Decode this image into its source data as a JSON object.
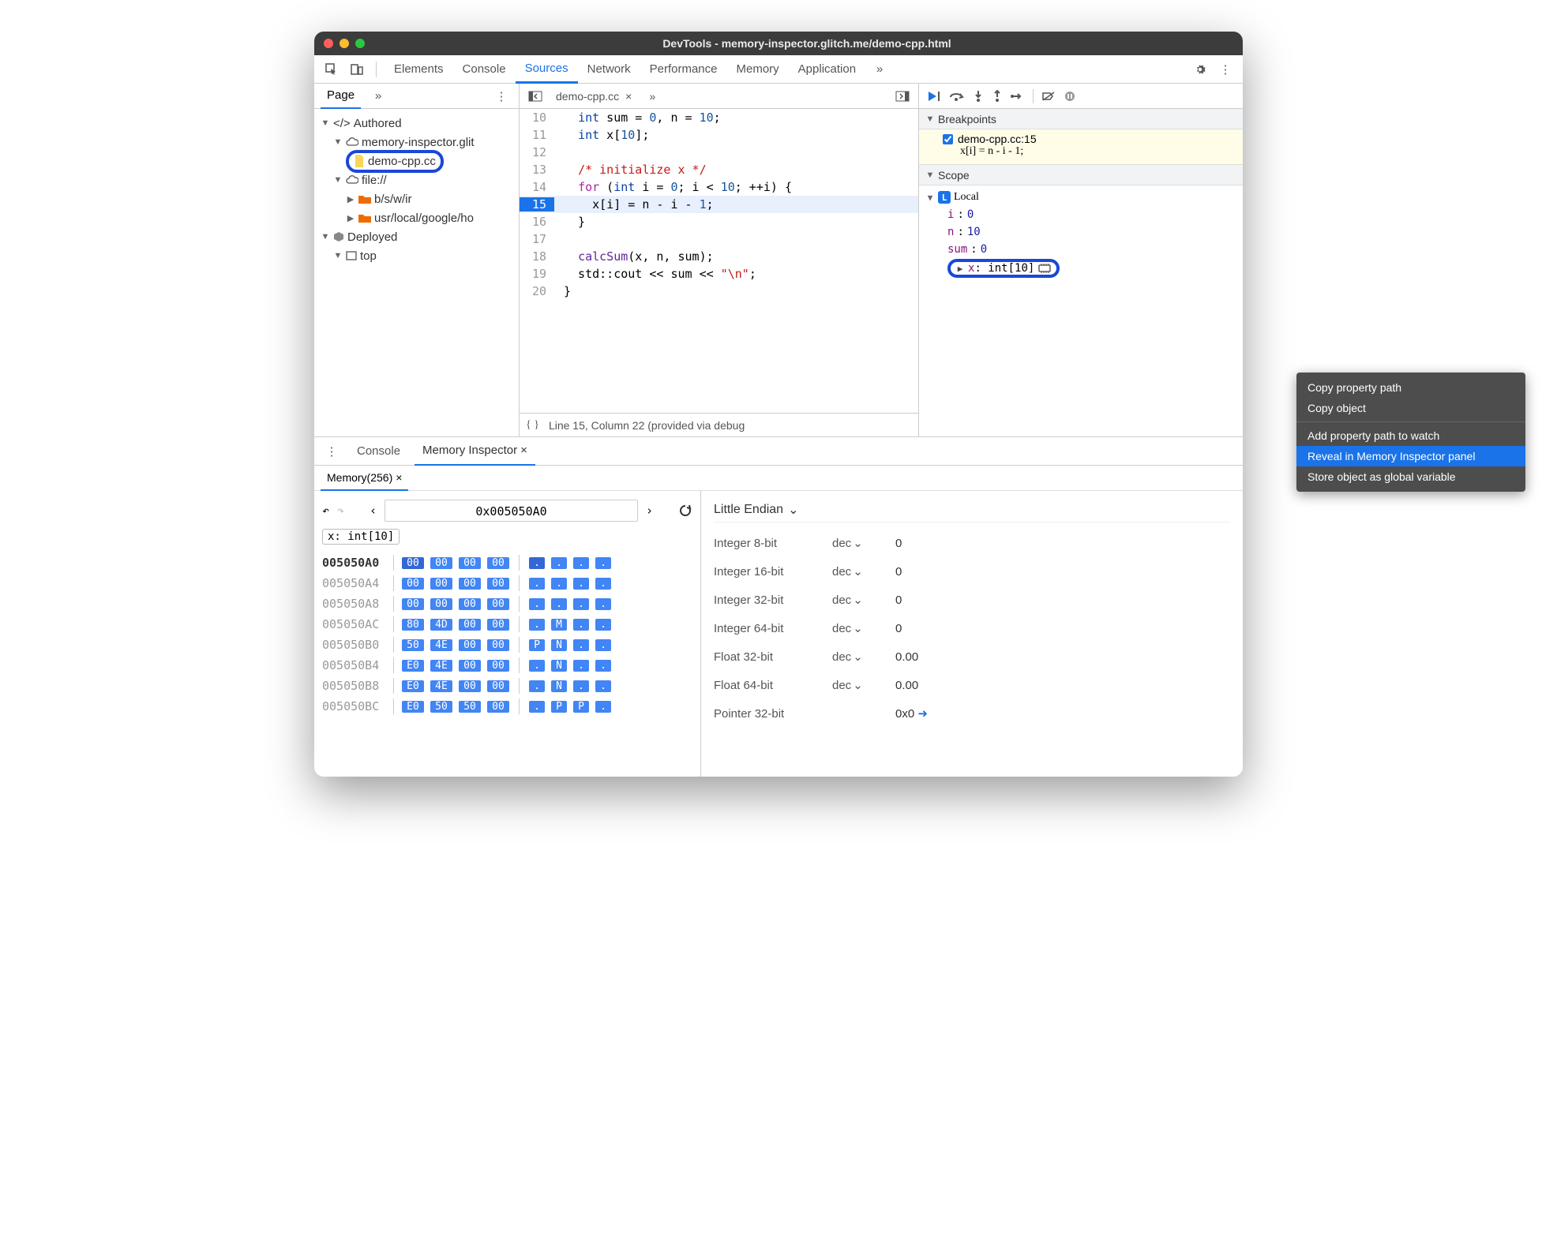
{
  "title": "DevTools - memory-inspector.glitch.me/demo-cpp.html",
  "tabs": [
    "Elements",
    "Console",
    "Sources",
    "Network",
    "Performance",
    "Memory",
    "Application"
  ],
  "activeTab": "Sources",
  "nav": {
    "pageTab": "Page",
    "tree": {
      "authored": "Authored",
      "host": "memory-inspector.glit",
      "file": "demo-cpp.cc",
      "filescheme": "file://",
      "bsw": "b/s/w/ir",
      "usr": "usr/local/google/ho",
      "deployed": "Deployed",
      "top": "top"
    }
  },
  "editor": {
    "filename": "demo-cpp.cc",
    "lines": [
      {
        "n": 10,
        "html": "  <span class='ty'>int</span> sum = <span class='num'>0</span>, n = <span class='num'>10</span>;"
      },
      {
        "n": 11,
        "html": "  <span class='ty'>int</span> x[<span class='num'>10</span>];"
      },
      {
        "n": 12,
        "html": ""
      },
      {
        "n": 13,
        "html": "  <span class='cm'>/* initialize x */</span>"
      },
      {
        "n": 14,
        "html": "  <span class='kw'>for</span> (<span class='ty'>int</span> i = <span class='num'>0</span>; i &lt; <span class='num'>10</span>; ++i) {"
      },
      {
        "n": 15,
        "html": "    x[i] = n - i - <span class='num'>1</span>;",
        "cur": true
      },
      {
        "n": 16,
        "html": "  }"
      },
      {
        "n": 17,
        "html": ""
      },
      {
        "n": 18,
        "html": "  <span class='fn'>calcSum</span>(x, n, sum);"
      },
      {
        "n": 19,
        "html": "  std::cout &lt;&lt; sum &lt;&lt; <span class='cm'>\"\\n\"</span>;"
      },
      {
        "n": 20,
        "html": "}"
      }
    ],
    "status": "Line 15, Column 22  (provided via debug"
  },
  "debugger": {
    "breakpoints": {
      "title": "Breakpoints",
      "file": "demo-cpp.cc:15",
      "code": "x[i] = n - i - 1;"
    },
    "scope": {
      "title": "Scope",
      "local": "Local",
      "vars": [
        {
          "name": "i",
          "val": "0"
        },
        {
          "name": "n",
          "val": "10"
        },
        {
          "name": "sum",
          "val": "0"
        }
      ],
      "xline": {
        "name": "x",
        "type": "int[10]"
      }
    }
  },
  "context_menu": [
    "Copy property path",
    "Copy object",
    "Add property path to watch",
    "Reveal in Memory Inspector panel",
    "Store object as global variable"
  ],
  "context_menu_sel": 3,
  "drawer": {
    "consoleTab": "Console",
    "miTab": "Memory Inspector",
    "memTab": "Memory(256)",
    "address": "0x005050A0",
    "chip": "x: int[10]",
    "hex": [
      {
        "addr": "005050A0",
        "b": [
          "00",
          "00",
          "00",
          "00"
        ],
        "a": [
          ".",
          ".",
          ".",
          "."
        ]
      },
      {
        "addr": "005050A4",
        "b": [
          "00",
          "00",
          "00",
          "00"
        ],
        "a": [
          ".",
          ".",
          ".",
          "."
        ]
      },
      {
        "addr": "005050A8",
        "b": [
          "00",
          "00",
          "00",
          "00"
        ],
        "a": [
          ".",
          ".",
          ".",
          "."
        ]
      },
      {
        "addr": "005050AC",
        "b": [
          "80",
          "4D",
          "00",
          "00"
        ],
        "a": [
          ".",
          "M",
          ".",
          "."
        ]
      },
      {
        "addr": "005050B0",
        "b": [
          "50",
          "4E",
          "00",
          "00"
        ],
        "a": [
          "P",
          "N",
          ".",
          "."
        ]
      },
      {
        "addr": "005050B4",
        "b": [
          "E0",
          "4E",
          "00",
          "00"
        ],
        "a": [
          ".",
          "N",
          ".",
          "."
        ]
      },
      {
        "addr": "005050B8",
        "b": [
          "E0",
          "4E",
          "00",
          "00"
        ],
        "a": [
          ".",
          "N",
          ".",
          "."
        ]
      },
      {
        "addr": "005050BC",
        "b": [
          "E0",
          "50",
          "50",
          "00"
        ],
        "a": [
          ".",
          "P",
          "P",
          "."
        ]
      }
    ],
    "values": {
      "endian": "Little Endian",
      "rows": [
        {
          "label": "Integer 8-bit",
          "fmt": "dec",
          "val": "0"
        },
        {
          "label": "Integer 16-bit",
          "fmt": "dec",
          "val": "0"
        },
        {
          "label": "Integer 32-bit",
          "fmt": "dec",
          "val": "0"
        },
        {
          "label": "Integer 64-bit",
          "fmt": "dec",
          "val": "0"
        },
        {
          "label": "Float 32-bit",
          "fmt": "dec",
          "val": "0.00"
        },
        {
          "label": "Float 64-bit",
          "fmt": "dec",
          "val": "0.00"
        },
        {
          "label": "Pointer 32-bit",
          "fmt": "",
          "val": "0x0"
        }
      ]
    }
  }
}
